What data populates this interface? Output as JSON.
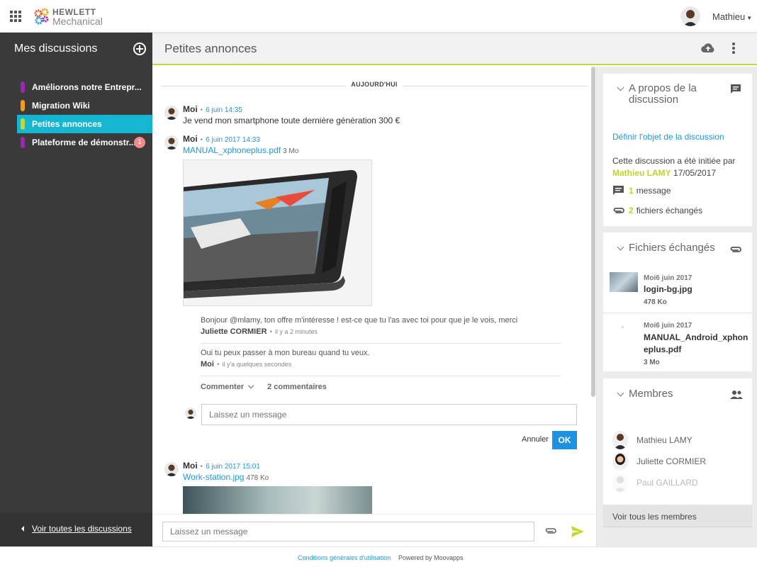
{
  "topbar": {
    "logo_line1": "HEWLETT",
    "logo_line2": "Mechanical",
    "user_name": "Mathieu"
  },
  "sidebar": {
    "title": "Mes discussions",
    "items": [
      {
        "label": "Améliorons notre Entrepr...",
        "color": "#9c27b0"
      },
      {
        "label": "Migration Wiki",
        "color": "#f39c12"
      },
      {
        "label": "Petites annonces",
        "color": "#c4d930",
        "active": true
      },
      {
        "label": "Plateforme de démonstr...",
        "color": "#9c27b0",
        "badge": "1"
      }
    ],
    "footer_link": "Voir toutes les discussions"
  },
  "header": {
    "title": "Petites annonces"
  },
  "chat": {
    "day_separator": "AUJOURD'HUI",
    "messages": [
      {
        "author": "Moi",
        "date": "6 juin 14:35",
        "text": "Je vend mon smartphone toute dernière génération 300 €"
      },
      {
        "author": "Moi",
        "date": "6 juin 2017 14:33",
        "file_name": "MANUAL_xphoneplus.pdf",
        "file_size": "3 Mo"
      },
      {
        "author": "Moi",
        "date": "6 juin 2017 15:01",
        "file_name": "Work-station.jpg",
        "file_size": "478 Ko"
      }
    ],
    "comments": [
      {
        "text": "Bonjour @mlamy, ton offre m'intéresse ! est-ce que tu l'as avec toi pour que je le vois, merci",
        "author": "Juliette CORMIER",
        "time": "il y a 2 minutes"
      },
      {
        "text": "Oui tu peux passer à mon bureau quand tu veux.",
        "author": "Moi",
        "time": "il y'a quelques secondes"
      }
    ],
    "comment_label": "Commenter",
    "comment_count": "2 commentaires",
    "reply_placeholder": "Laissez un message",
    "cancel_label": "Annuler",
    "ok_label": "OK",
    "compose_placeholder": "Laissez un message"
  },
  "about": {
    "title": "A propos de la discussion",
    "define_link": "Définir l'objet de la discussion",
    "initiated_text": "Cette discussion a été initiée par",
    "initiator": "Mathieu LAMY",
    "initiated_date": "17/05/2017",
    "messages_count": "1",
    "messages_label": "message",
    "files_count": "2",
    "files_label": "fichiers échangés"
  },
  "files": {
    "title": "Fichiers échangés",
    "items": [
      {
        "date": "Moi6 juin 2017",
        "name": "login-bg.jpg",
        "size": "478 Ko"
      },
      {
        "date": "Moi6 juin 2017",
        "name": "MANUAL_Android_xphoneplus.pdf",
        "size": "3 Mo"
      }
    ]
  },
  "members": {
    "title": "Membres",
    "items": [
      {
        "name": "Mathieu LAMY"
      },
      {
        "name": "Juliette CORMIER"
      },
      {
        "name": "Paul GAILLARD"
      }
    ],
    "see_all": "Voir tous les membres"
  },
  "footer": {
    "cgu": "Conditions générales d'utilisation",
    "powered": "Powered by Moovapps"
  },
  "colors": {
    "accent_blue": "#16b6d2",
    "link_blue": "#2196d9",
    "highlight_green": "#c4d930",
    "sidebar_bg": "#3a3a3a"
  }
}
